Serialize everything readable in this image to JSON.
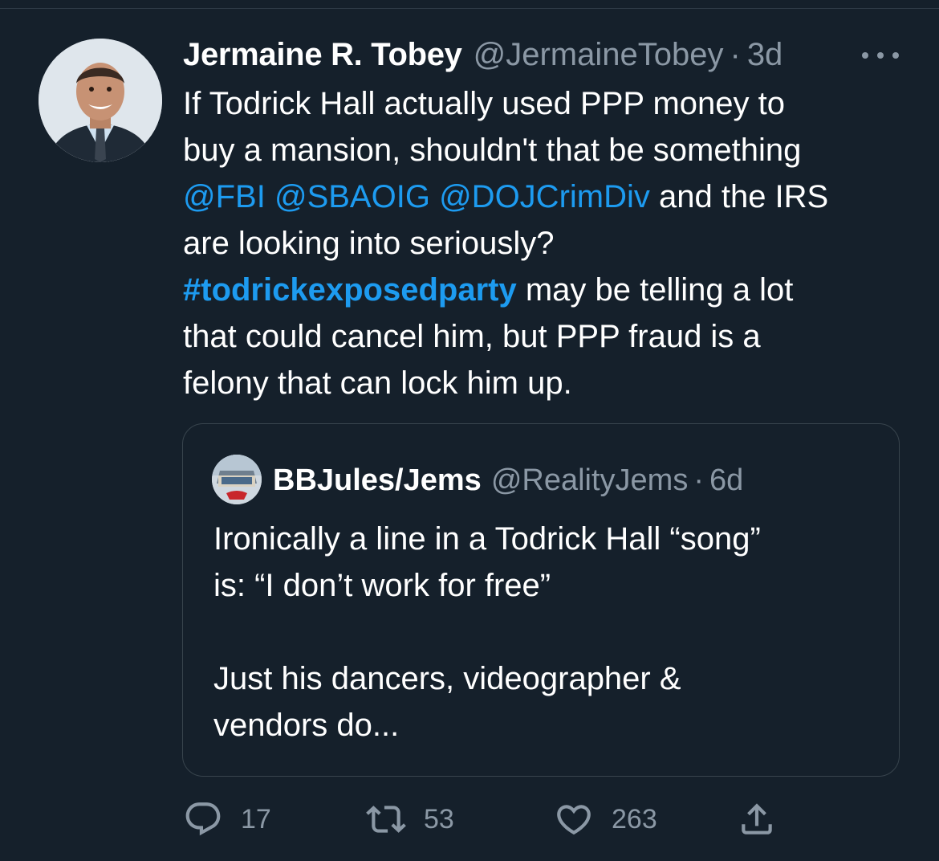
{
  "tweet": {
    "author_name": "Jermaine R. Tobey",
    "handle": "@JermaineTobey",
    "separator": "·",
    "time": "3d",
    "text_lines": [
      [
        {
          "t": "If Todrick Hall actually used PPP money to",
          "k": "text"
        }
      ],
      [
        {
          "t": "buy a mansion, shouldn't that be something",
          "k": "text"
        }
      ],
      [
        {
          "t": "@FBI",
          "k": "link"
        },
        {
          "t": " ",
          "k": "text"
        },
        {
          "t": "@SBAOIG",
          "k": "link"
        },
        {
          "t": " ",
          "k": "text"
        },
        {
          "t": "@DOJCrimDiv",
          "k": "link"
        },
        {
          "t": " and the IRS",
          "k": "text"
        }
      ],
      [
        {
          "t": "are looking into seriously?",
          "k": "text"
        }
      ],
      [
        {
          "t": "#todrickexposedparty",
          "k": "hashtag"
        },
        {
          "t": " may be telling a lot",
          "k": "text"
        }
      ],
      [
        {
          "t": "that could cancel him, but PPP fraud is a",
          "k": "text"
        }
      ],
      [
        {
          "t": "felony that can lock him up.",
          "k": "text"
        }
      ]
    ]
  },
  "quoted_tweet": {
    "author_name": "BBJules/Jems",
    "handle": "@RealityJems",
    "separator": "·",
    "time": "6d",
    "text_lines": [
      "Ironically a line in a Todrick Hall “song”",
      "is: “I don’t work for free”",
      "",
      "Just his dancers, videographer &",
      "vendors do..."
    ]
  },
  "actions": {
    "reply_count": "17",
    "retweet_count": "53",
    "like_count": "263"
  },
  "icons": {
    "more": "more-icon",
    "reply": "reply-icon",
    "retweet": "retweet-icon",
    "like": "heart-icon",
    "share": "share-icon"
  },
  "colors": {
    "background": "#15202b",
    "link": "#1d9bf0",
    "secondary_text": "#8b98a5",
    "border": "#38444d"
  }
}
